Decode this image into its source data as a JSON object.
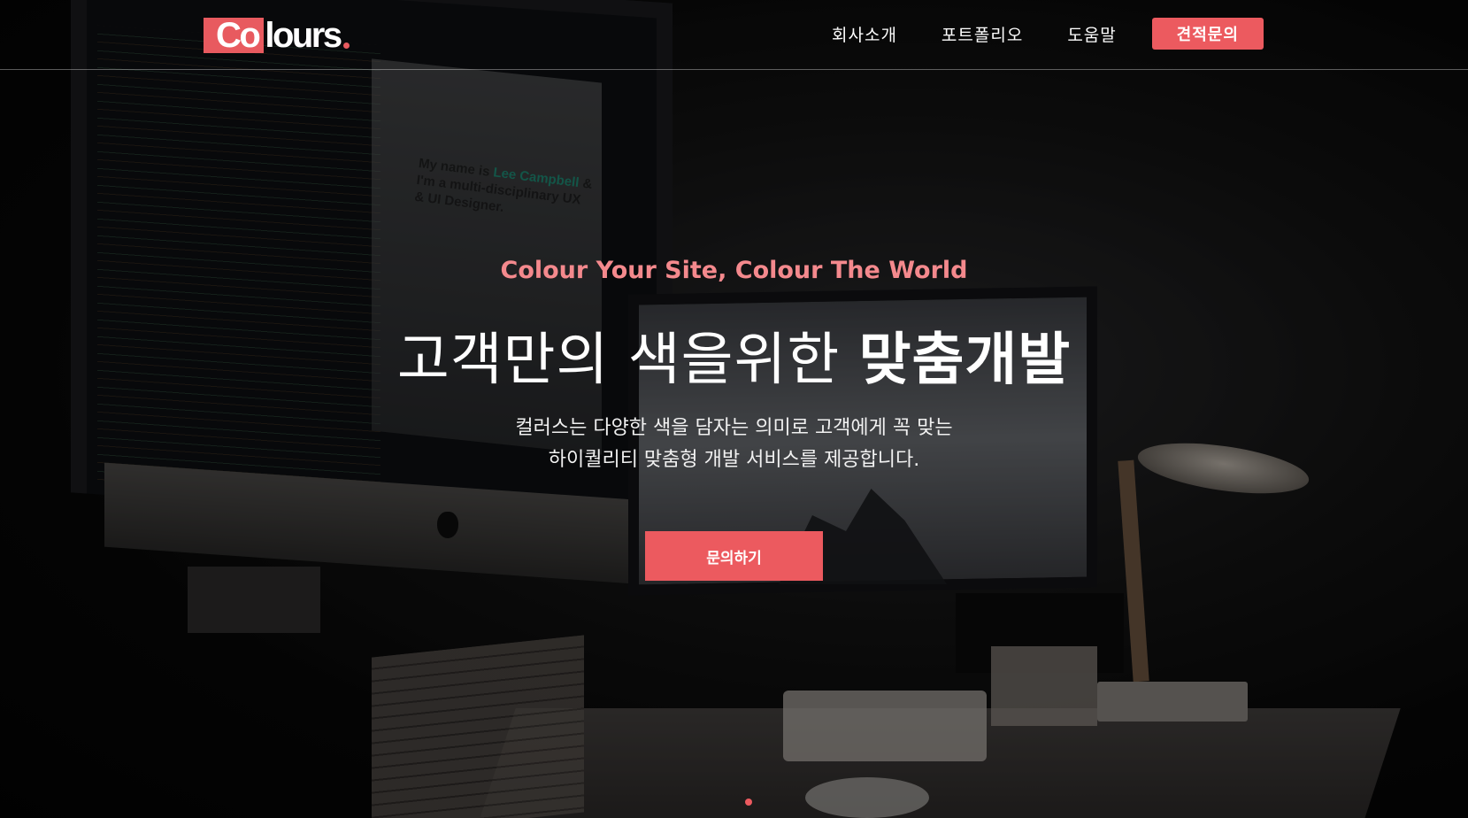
{
  "header": {
    "logo": {
      "main": "Co",
      "rest": "lours"
    },
    "nav": [
      "회사소개",
      "포트폴리오",
      "도움말"
    ],
    "quote_button": "견적문의"
  },
  "hero": {
    "tagline": "Colour Your Site, Colour The World",
    "headline_light": "고객만의 색을위한",
    "headline_bold": "맞춤개발",
    "subtext_line1": "컬러스는 다양한 색을 담자는 의미로 고객에게 꼭 맞는",
    "subtext_line2": "하이퀄리티 맞춤형 개발 서비스를 제공합니다.",
    "cta_label": "문의하기"
  },
  "background_photo": {
    "screen_text_1": "My name is",
    "screen_text_accent": "Lee Campbell",
    "screen_text_2": "& I'm a multi-disciplinary UX & UI Designer."
  },
  "colors": {
    "accent": "#ec5a5f",
    "tagline": "#f4898d"
  }
}
